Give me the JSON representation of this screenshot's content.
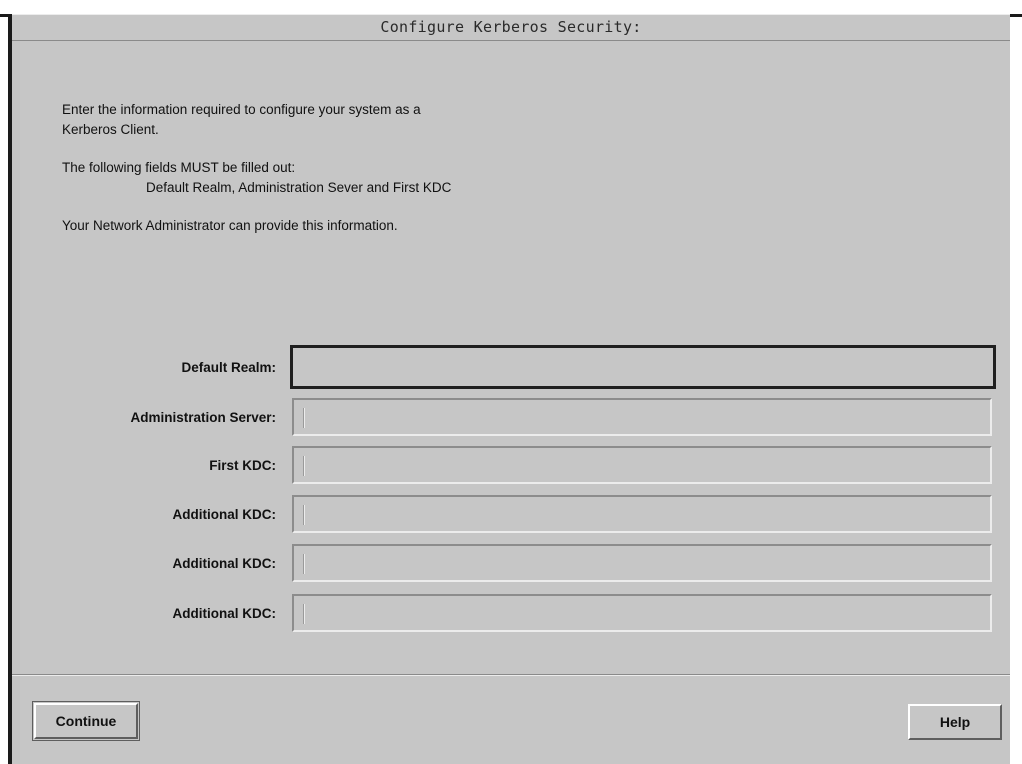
{
  "window": {
    "title": "Configure Kerberos Security:"
  },
  "intro": {
    "line1": "Enter the information required to configure your system as a",
    "line2": "Kerberos Client.",
    "line3": "The following fields MUST be filled out:",
    "line4": "Default Realm, Administration Sever and First KDC",
    "line5": "Your Network Administrator can provide this information."
  },
  "form": {
    "fields": [
      {
        "label": "Default Realm:",
        "value": ""
      },
      {
        "label": "Administration Server:",
        "value": ""
      },
      {
        "label": "First KDC:",
        "value": ""
      },
      {
        "label": "Additional KDC:",
        "value": ""
      },
      {
        "label": "Additional KDC:",
        "value": ""
      },
      {
        "label": "Additional KDC:",
        "value": ""
      }
    ]
  },
  "buttons": {
    "continue": "Continue",
    "help": "Help"
  },
  "colors": {
    "window_bg": "#c6c6c6",
    "focus_border": "#1f1f1f"
  }
}
